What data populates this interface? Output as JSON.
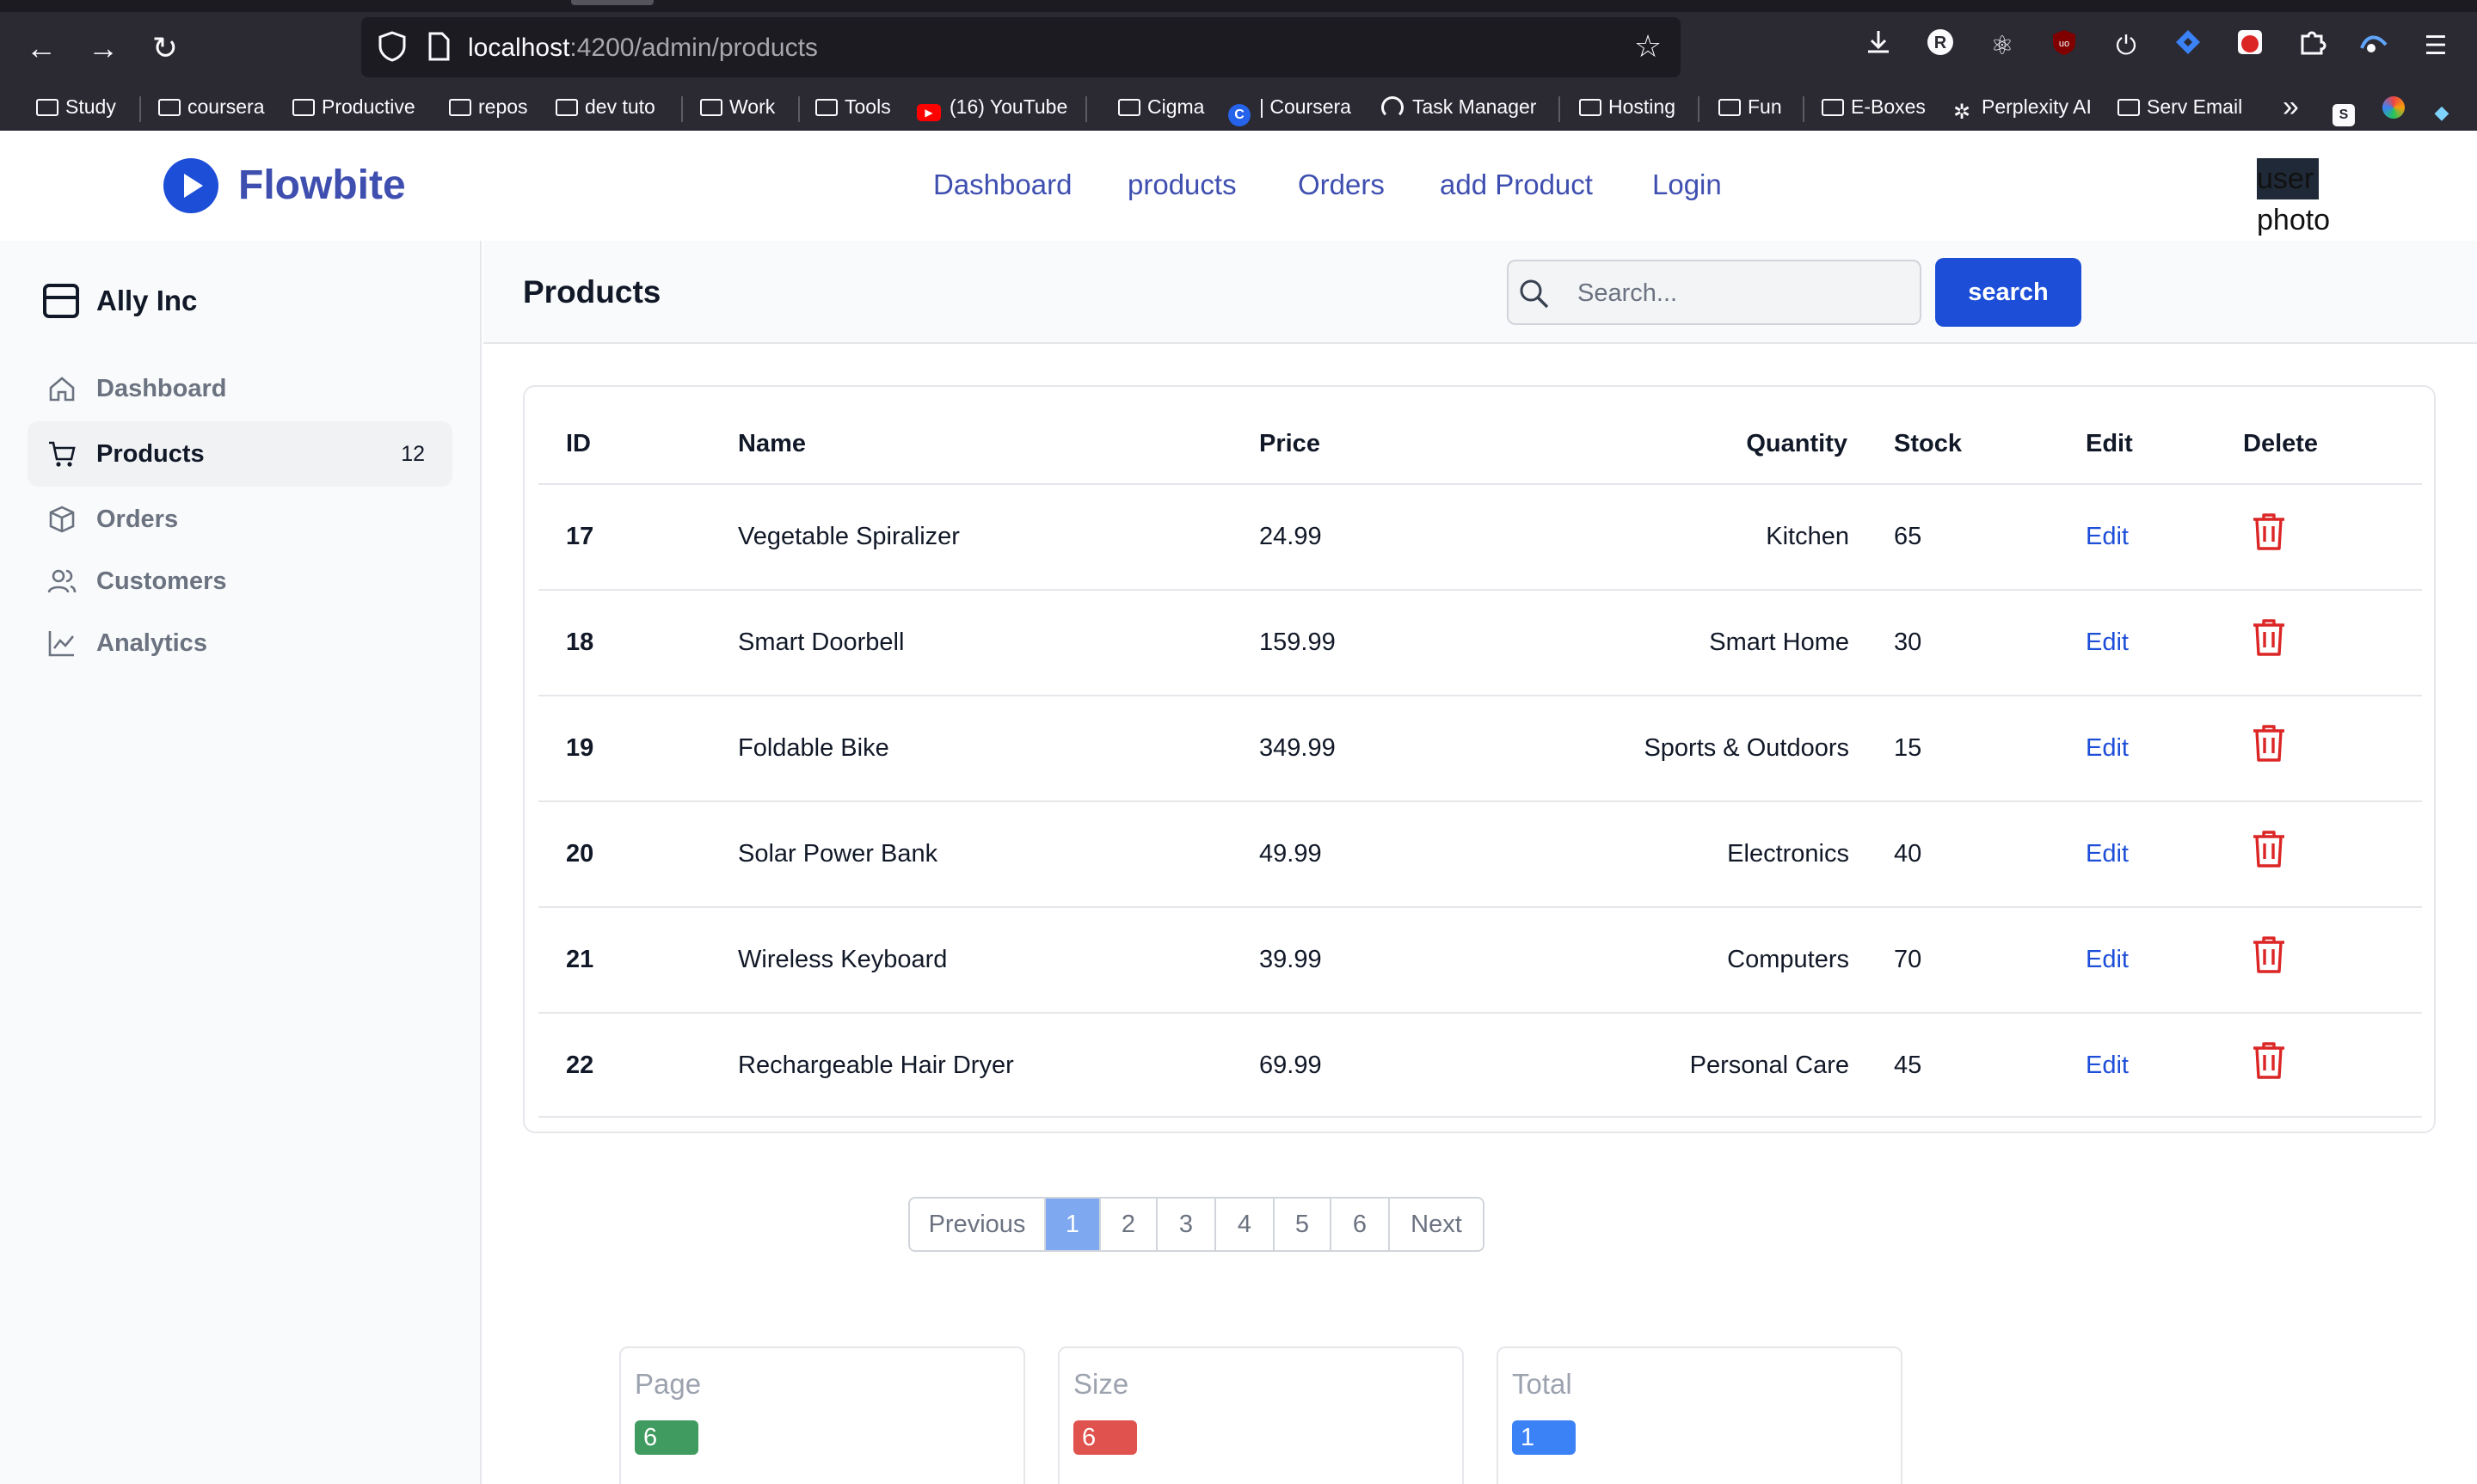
{
  "browser": {
    "url_host": "localhost",
    "url_path": ":4200/admin/products",
    "bookmarks": [
      {
        "label": "Study",
        "kind": "folder"
      },
      {
        "label": "coursera",
        "kind": "folder"
      },
      {
        "label": "Productive",
        "kind": "folder"
      },
      {
        "label": "repos",
        "kind": "folder"
      },
      {
        "label": "dev tuto",
        "kind": "folder"
      },
      {
        "label": "Work",
        "kind": "folder"
      },
      {
        "label": "Tools",
        "kind": "folder"
      },
      {
        "label": "(16) YouTube",
        "kind": "youtube"
      },
      {
        "label": "Cigma",
        "kind": "folder"
      },
      {
        "label": "| Coursera",
        "kind": "coursera"
      },
      {
        "label": "Task Manager",
        "kind": "gauge"
      },
      {
        "label": "Hosting",
        "kind": "folder"
      },
      {
        "label": "Fun",
        "kind": "folder"
      },
      {
        "label": "E-Boxes",
        "kind": "folder"
      },
      {
        "label": "Perplexity AI",
        "kind": "perplexity"
      },
      {
        "label": "Serv Email",
        "kind": "folder"
      }
    ],
    "more_glyph": "»"
  },
  "app": {
    "brand": "Flowbite",
    "nav": [
      "Dashboard",
      "products",
      "Orders",
      "add Product",
      "Login"
    ],
    "user_photo_line1": "user",
    "user_photo_line2": "photo"
  },
  "sidebar": {
    "org": "Ally Inc",
    "items": [
      {
        "label": "Dashboard",
        "icon": "home-icon",
        "count": ""
      },
      {
        "label": "Products",
        "icon": "cart-icon",
        "count": "12",
        "active": true
      },
      {
        "label": "Orders",
        "icon": "box-icon",
        "count": ""
      },
      {
        "label": "Customers",
        "icon": "users-icon",
        "count": ""
      },
      {
        "label": "Analytics",
        "icon": "chart-line-icon",
        "count": ""
      }
    ]
  },
  "main": {
    "title": "Products",
    "search_placeholder": "Search...",
    "search_button": "search"
  },
  "table": {
    "headers": {
      "id": "ID",
      "name": "Name",
      "price": "Price",
      "quantity": "Quantity",
      "stock": "Stock",
      "edit": "Edit",
      "delete": "Delete"
    },
    "rows": [
      {
        "id": "17",
        "name": "Vegetable Spiralizer",
        "price": "24.99",
        "quantity": "Kitchen",
        "stock": "65",
        "edit": "Edit"
      },
      {
        "id": "18",
        "name": "Smart Doorbell",
        "price": "159.99",
        "quantity": "Smart Home",
        "stock": "30",
        "edit": "Edit"
      },
      {
        "id": "19",
        "name": "Foldable Bike",
        "price": "349.99",
        "quantity": "Sports & Outdoors",
        "stock": "15",
        "edit": "Edit"
      },
      {
        "id": "20",
        "name": "Solar Power Bank",
        "price": "49.99",
        "quantity": "Electronics",
        "stock": "40",
        "edit": "Edit"
      },
      {
        "id": "21",
        "name": "Wireless Keyboard",
        "price": "39.99",
        "quantity": "Computers",
        "stock": "70",
        "edit": "Edit"
      },
      {
        "id": "22",
        "name": "Rechargeable Hair Dryer",
        "price": "69.99",
        "quantity": "Personal Care",
        "stock": "45",
        "edit": "Edit"
      }
    ]
  },
  "pagination": {
    "previous": "Previous",
    "pages": [
      "1",
      "2",
      "3",
      "4",
      "5",
      "6"
    ],
    "current": "1",
    "next": "Next"
  },
  "stats": [
    {
      "label": "Page",
      "value": "6",
      "color": "#3f9b5f"
    },
    {
      "label": "Size",
      "value": "6",
      "color": "#e0524d"
    },
    {
      "label": "Total",
      "value": "1",
      "color": "#3b82f6"
    }
  ],
  "colors": {
    "accent": "#1d4ed8",
    "brand": "#3f4fb0",
    "delete": "#dc2626"
  }
}
